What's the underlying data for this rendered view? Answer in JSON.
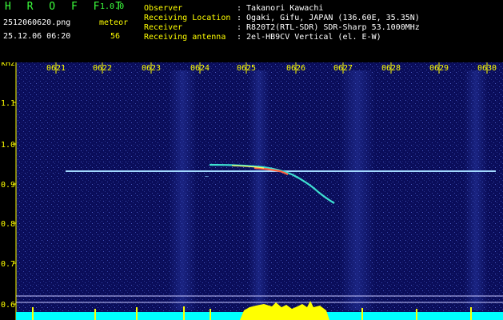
{
  "header": {
    "brand": "H R O F F T",
    "version": "1.0.0",
    "filename": "2512060620.png",
    "datetime": "25.12.06 06:20",
    "meteor_label": "meteor",
    "meteor_count": "56"
  },
  "info": {
    "labels": [
      "Observer",
      "Receiving Location",
      "Receiver",
      "Receiving antenna"
    ],
    "values": [
      ": Takanori Kawachi",
      ": Ogaki, Gifu, JAPAN (136.60E, 35.35N)",
      ": R820T2(RTL-SDR) SDR-Sharp 53.1000MHz",
      ": 2el-HB9CV Vertical (el. E-W)"
    ]
  },
  "axis": {
    "unit": "kHz",
    "x_ticks": [
      "0621",
      "0622",
      "0623",
      "0624",
      "0625",
      "0626",
      "0627",
      "0628",
      "0629",
      "0630"
    ],
    "y_ticks": [
      "1.1",
      "1.0",
      "0.9",
      "0.8",
      "0.7",
      "0.6"
    ]
  },
  "colors": {
    "background": "#0a0d5a",
    "carrier": "#8fd0ff",
    "meteor": "#ff6040",
    "labels": "#ffff00",
    "level_cyan": "#00ffff",
    "level_yellow": "#ffff00"
  }
}
